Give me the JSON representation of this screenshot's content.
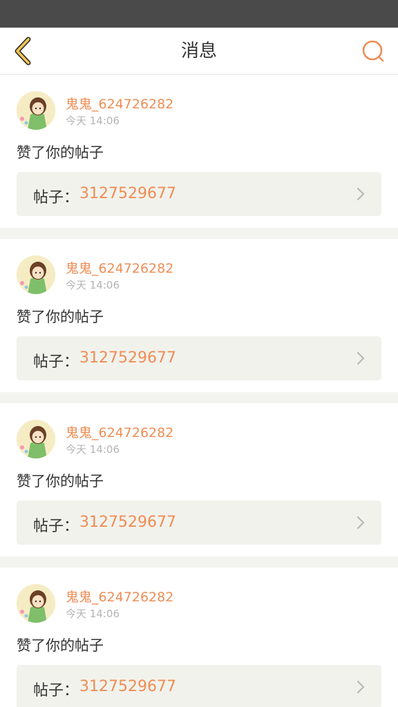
{
  "header": {
    "title": "消息",
    "back_icon": "chevron-left-icon",
    "search_icon": "search-icon",
    "accent_color": "#ee8d55",
    "back_color": "#f4c64f"
  },
  "messages": [
    {
      "username": "鬼鬼_624726282",
      "time": "今天 14:06",
      "action": "赞了你的帖子",
      "post_prefix": "帖子：",
      "post_number": "3127529677"
    },
    {
      "username": "鬼鬼_624726282",
      "time": "今天 14:06",
      "action": "赞了你的帖子",
      "post_prefix": "帖子：",
      "post_number": "3127529677"
    },
    {
      "username": "鬼鬼_624726282",
      "time": "今天 14:06",
      "action": "赞了你的帖子",
      "post_prefix": "帖子：",
      "post_number": "3127529677"
    },
    {
      "username": "鬼鬼_624726282",
      "time": "今天 14:06",
      "action": "赞了你的帖子",
      "post_prefix": "帖子：",
      "post_number": "3127529677"
    }
  ]
}
